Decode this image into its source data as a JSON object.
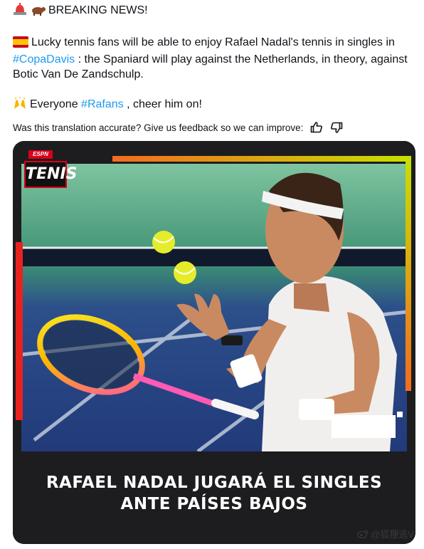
{
  "tweet": {
    "line1_text": "BREAKING NEWS!",
    "line2_pre": "Lucky tennis fans will be able to enjoy Rafael Nadal's tennis in singles in ",
    "hashtag1": "#CopaDavis",
    "line2_post": " : the Spaniard will play against the Netherlands, in theory, against Botic Van De Zandschulp.",
    "line3_pre": "Everyone ",
    "hashtag2": "#Rafans",
    "line3_post": " , cheer him on!"
  },
  "icons": {
    "siren": "police-light-icon",
    "bull": "bull-icon",
    "flag": "spain-flag-icon",
    "hands": "raising-hands-icon",
    "thumbs_up": "thumbs-up-icon",
    "thumbs_down": "thumbs-down-icon"
  },
  "feedback": {
    "text": "Was this translation accurate? Give us feedback so we can improve:"
  },
  "media": {
    "brand_small": "ESPN",
    "brand_logo": "TENIS",
    "headline_line1": "RAFAEL NADAL JUGARÁ EL SINGLES",
    "headline_line2": "ANTE PAÍSES BAJOS"
  },
  "watermark": {
    "text": "@狐狸逃V"
  },
  "colors": {
    "hashtag": "#1d9bf0",
    "text": "#0f1419",
    "image_bg": "#1d1d1f",
    "accent_orange": "#f26b21",
    "accent_lime": "#c6e000",
    "accent_red": "#e8231e"
  }
}
